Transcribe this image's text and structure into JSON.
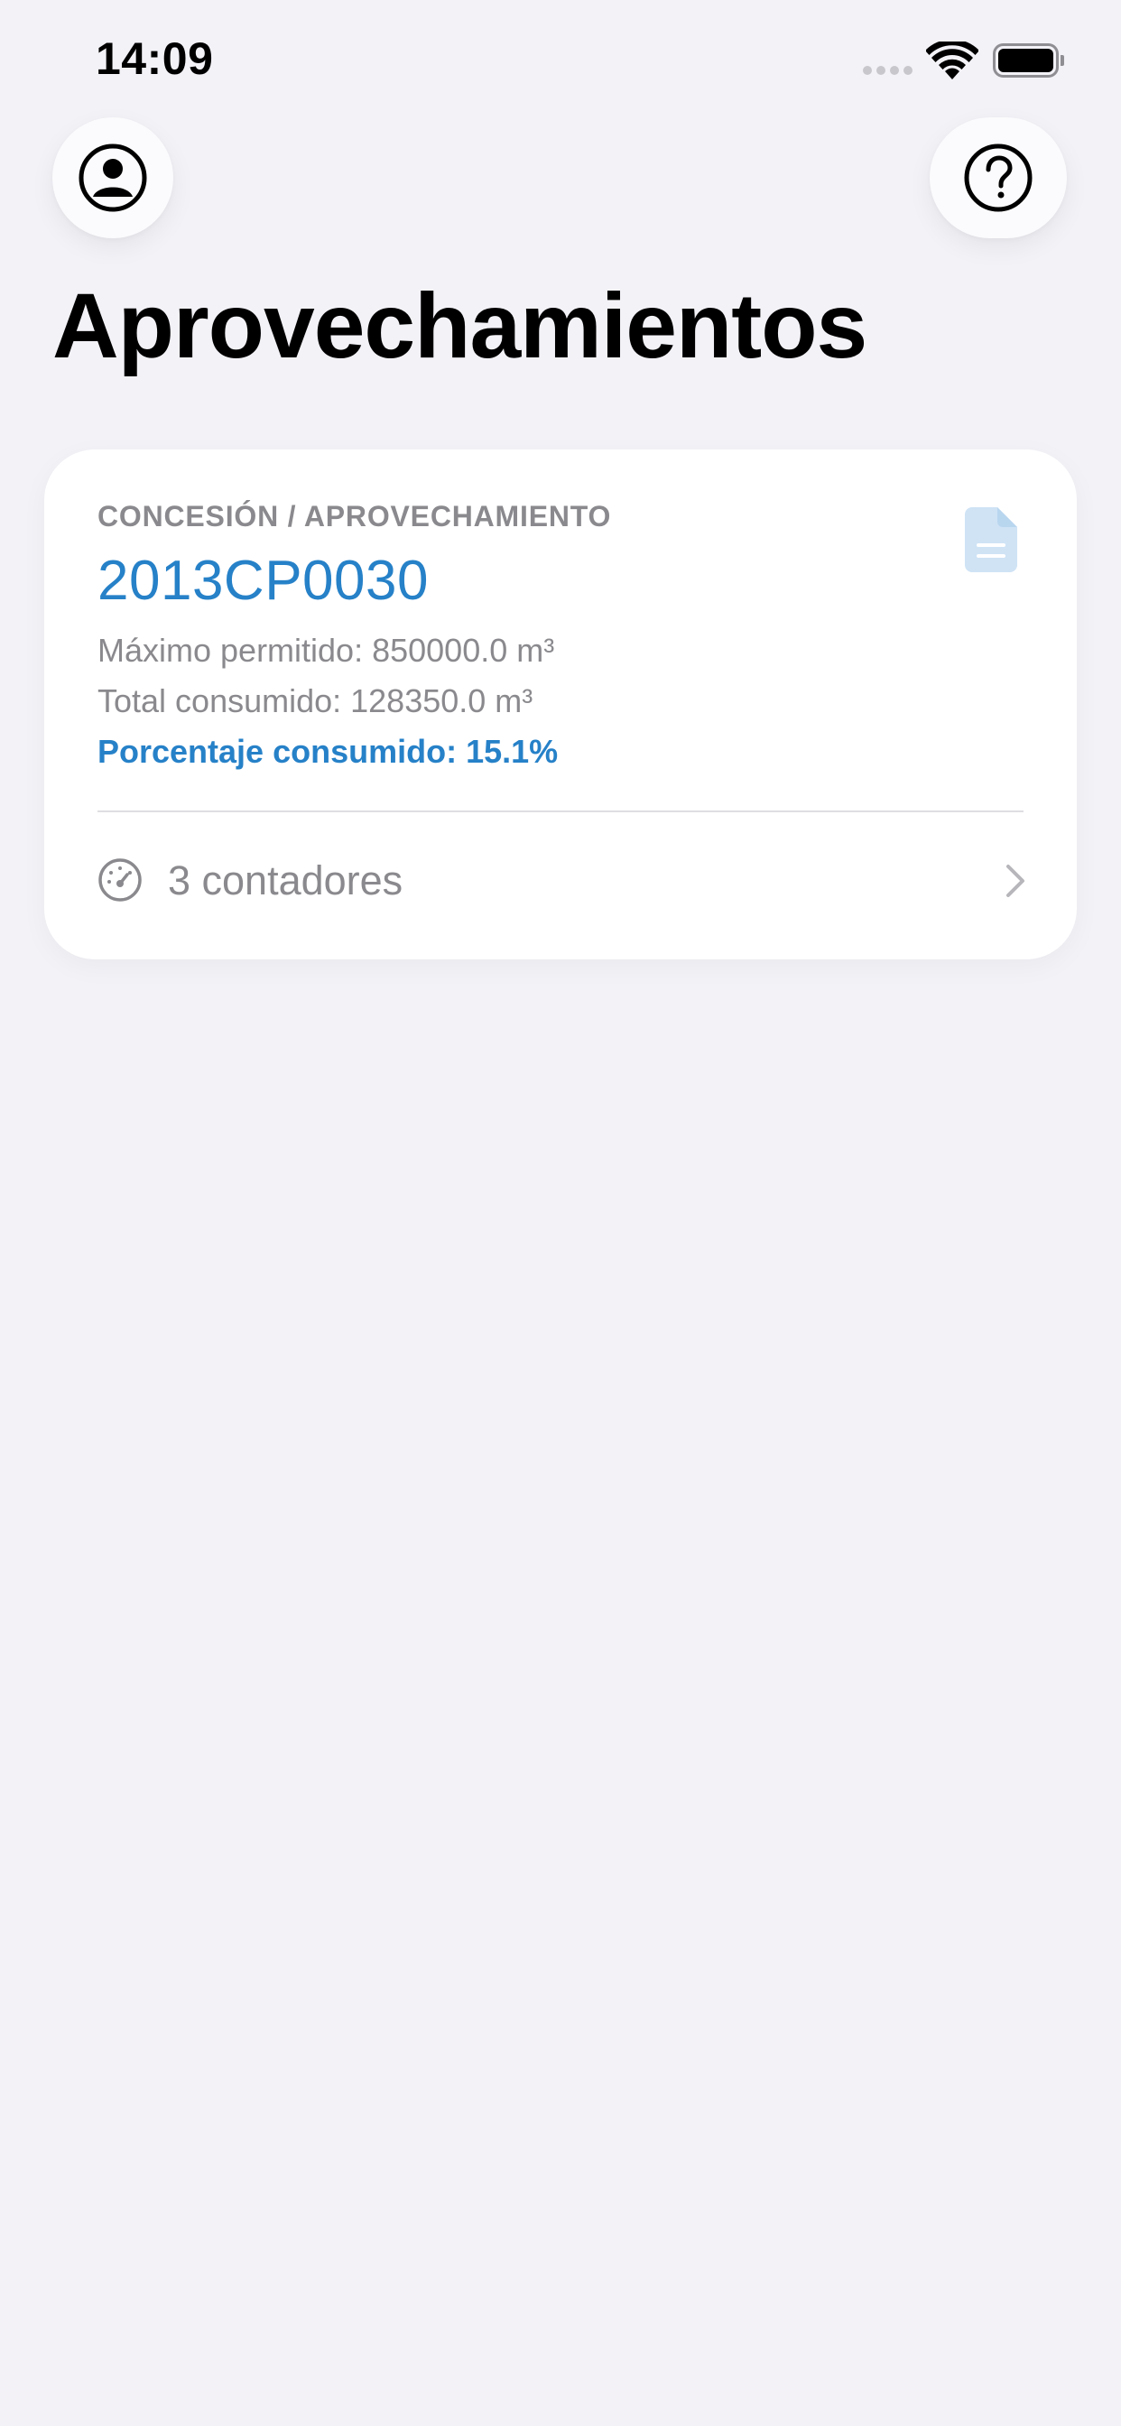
{
  "status_bar": {
    "time": "14:09",
    "icons": [
      "cellular-signal-icon",
      "wifi-icon",
      "battery-icon"
    ]
  },
  "header": {
    "profile_button_icon": "person-circle-icon",
    "help_button_icon": "question-circle-icon"
  },
  "page": {
    "title": "Aprovechamientos"
  },
  "card": {
    "eyebrow": "CONCESIÓN / APROVECHAMIENTO",
    "code": "2013CP0030",
    "max_allowed": "Máximo permitido: 850000.0 m³",
    "total_consumed": "Total consumido: 128350.0 m³",
    "percent_consumed": "Porcentaje consumido: 15.1%",
    "document_icon": "document-icon",
    "counters_icon": "gauge-icon",
    "counters_label": "3 contadores",
    "chevron_icon": "chevron-right-icon"
  },
  "colors": {
    "background": "#f2f2f7",
    "card": "#ffffff",
    "accent": "#2681c8",
    "secondary_text": "#8a8a8e",
    "document_icon": "#cfe3f5"
  }
}
